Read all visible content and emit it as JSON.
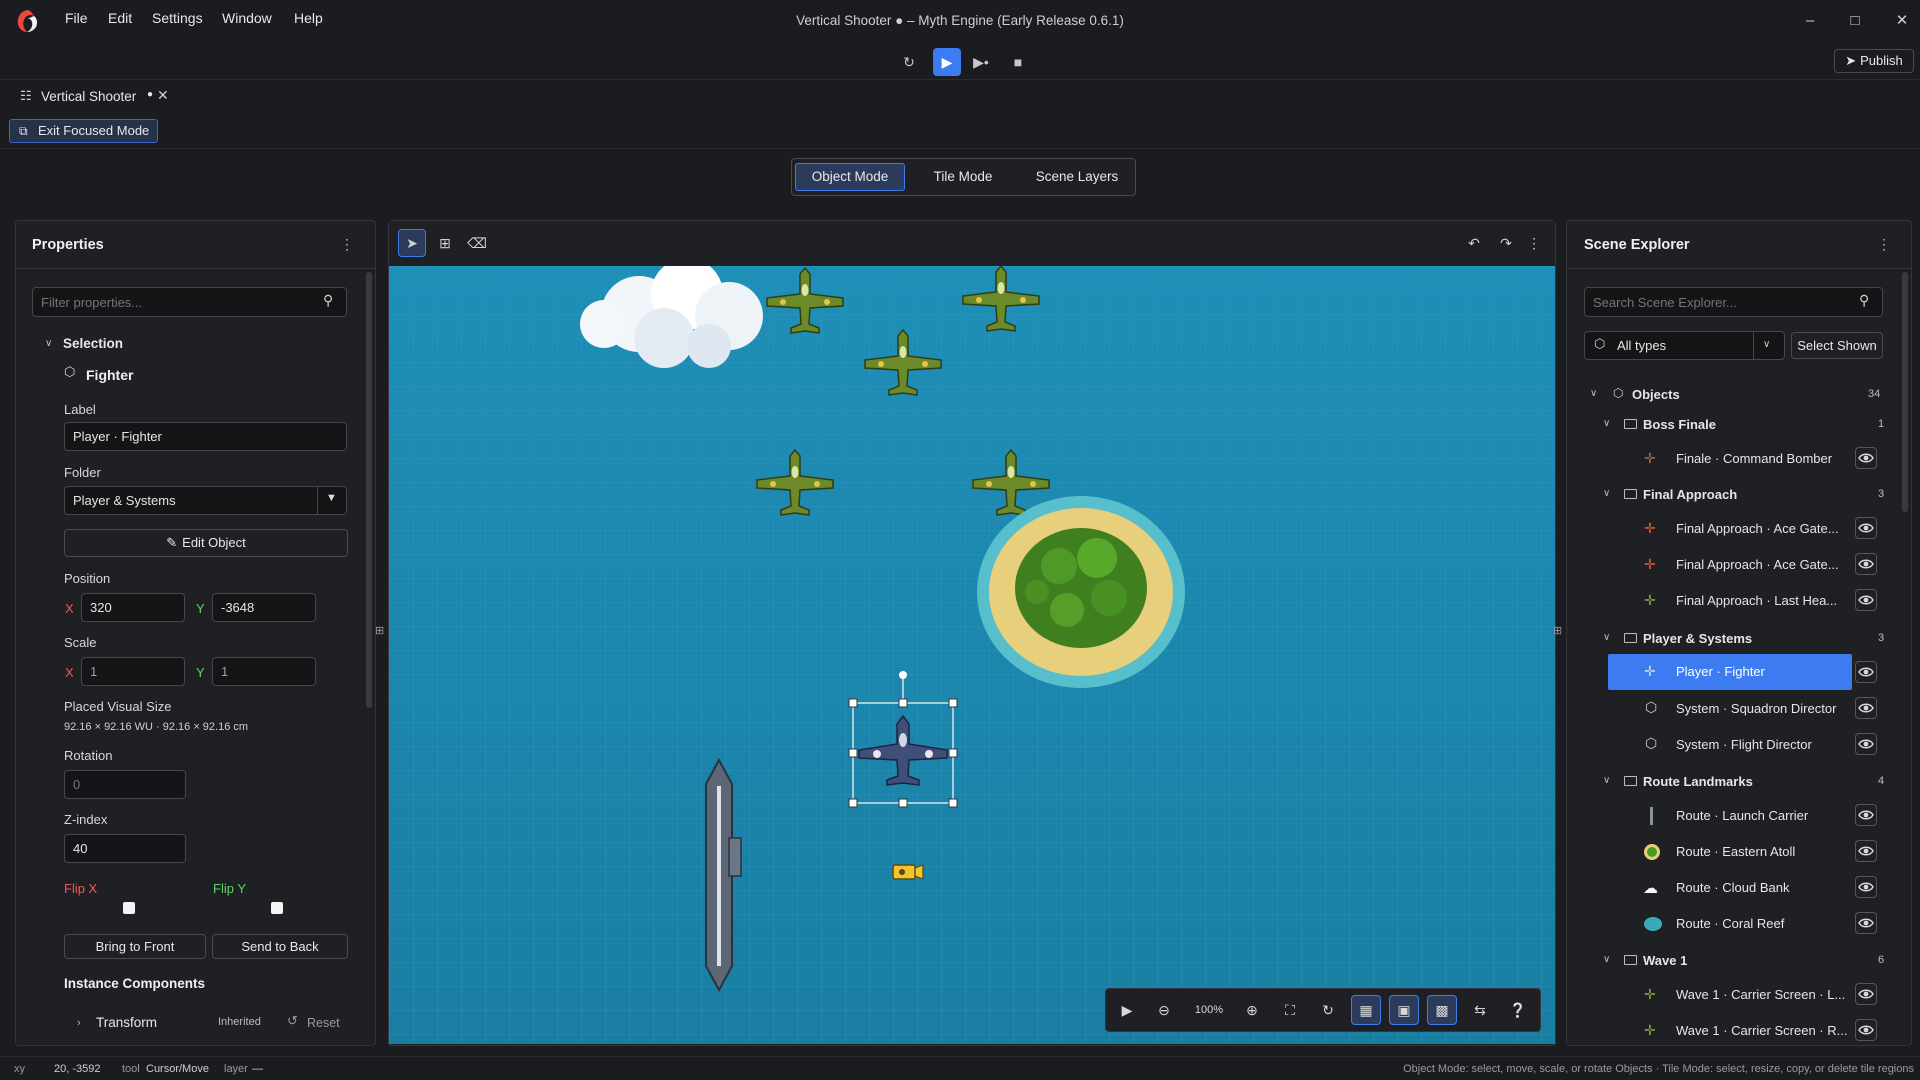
{
  "app": {
    "window_title": "Vertical Shooter ● – Myth Engine (Early Release 0.6.1)",
    "menu": [
      "File",
      "Edit",
      "Settings",
      "Window",
      "Help"
    ],
    "accent_color": "#3d7cf0"
  },
  "toolbar": {
    "publish_label": "Publish",
    "buttons": [
      "restart-icon",
      "play-icon",
      "play-from-here-icon",
      "stop-icon"
    ]
  },
  "document_tab": {
    "label": "Vertical Shooter",
    "modified_marker": "●"
  },
  "focus": {
    "exit_label": "Exit Focused Mode"
  },
  "modes": {
    "object": "Object Mode",
    "tile": "Tile Mode",
    "layers": "Scene Layers",
    "active": "Object Mode"
  },
  "properties": {
    "title": "Properties",
    "filter_placeholder": "Filter properties...",
    "selection_header": "Selection",
    "object_type": "Fighter",
    "label_caption": "Label",
    "label_value": "Player · Fighter",
    "folder_caption": "Folder",
    "folder_value": "Player & Systems",
    "edit_object_label": "Edit Object",
    "position_caption": "Position",
    "pos_x": "320",
    "pos_y": "-3648",
    "scale_caption": "Scale",
    "scale_x": "1",
    "scale_y": "1",
    "axis_x": "X",
    "axis_y": "Y",
    "visual_size_caption": "Placed Visual Size",
    "visual_size_value": "92.16 × 92.16 WU · 92.16 × 92.16 cm",
    "rotation_caption": "Rotation",
    "rotation_placeholder": "0",
    "zindex_caption": "Z-index",
    "zindex_value": "40",
    "flip_x_caption": "Flip X",
    "flip_y_caption": "Flip Y",
    "bring_front_label": "Bring to Front",
    "send_back_label": "Send to Back",
    "components_caption": "Instance Components",
    "transform_label": "Transform",
    "inherited_label": "Inherited",
    "reset_label": "Reset"
  },
  "scene_explorer": {
    "title": "Scene Explorer",
    "search_placeholder": "Search Scene Explorer...",
    "type_filter": "All types",
    "select_shown_label": "Select Shown",
    "root": {
      "label": "Objects",
      "count": "34"
    },
    "groups": [
      {
        "label": "Boss Finale",
        "count": "1",
        "items": [
          {
            "label": "Finale · Command Bomber",
            "icon": "bomber-icon"
          }
        ]
      },
      {
        "label": "Final Approach",
        "count": "3",
        "items": [
          {
            "label": "Final Approach · Ace Gate...",
            "icon": "red-plane-icon"
          },
          {
            "label": "Final Approach · Ace Gate...",
            "icon": "red-plane-icon"
          },
          {
            "label": "Final Approach · Last Hea...",
            "icon": "green-plane-icon"
          }
        ]
      },
      {
        "label": "Player & Systems",
        "count": "3",
        "items": [
          {
            "label": "Player · Fighter",
            "icon": "player-plane-icon",
            "selected": true
          },
          {
            "label": "System · Squadron Director",
            "icon": "cube-icon"
          },
          {
            "label": "System · Flight Director",
            "icon": "cube-icon"
          }
        ]
      },
      {
        "label": "Route Landmarks",
        "count": "4",
        "items": [
          {
            "label": "Route · Launch Carrier",
            "icon": "carrier-icon"
          },
          {
            "label": "Route · Eastern Atoll",
            "icon": "atoll-icon"
          },
          {
            "label": "Route · Cloud Bank",
            "icon": "cloud-icon"
          },
          {
            "label": "Route · Coral Reef",
            "icon": "reef-icon"
          }
        ]
      },
      {
        "label": "Wave 1",
        "count": "6",
        "items": [
          {
            "label": "Wave 1 · Carrier Screen · L...",
            "icon": "green-plane-icon"
          },
          {
            "label": "Wave 1 · Carrier Screen · R...",
            "icon": "green-plane-icon"
          }
        ]
      }
    ]
  },
  "viewport": {
    "zoom": "100%"
  },
  "status": {
    "xy_caption": "xy",
    "xy_value": "20, -3592",
    "tool_caption": "tool",
    "tool_value": "Cursor/Move",
    "layer_caption": "layer",
    "layer_value": "—",
    "hint": "Object Mode: select, move, scale, or rotate Objects · Tile Mode: select, resize, copy, or delete tile regions"
  }
}
